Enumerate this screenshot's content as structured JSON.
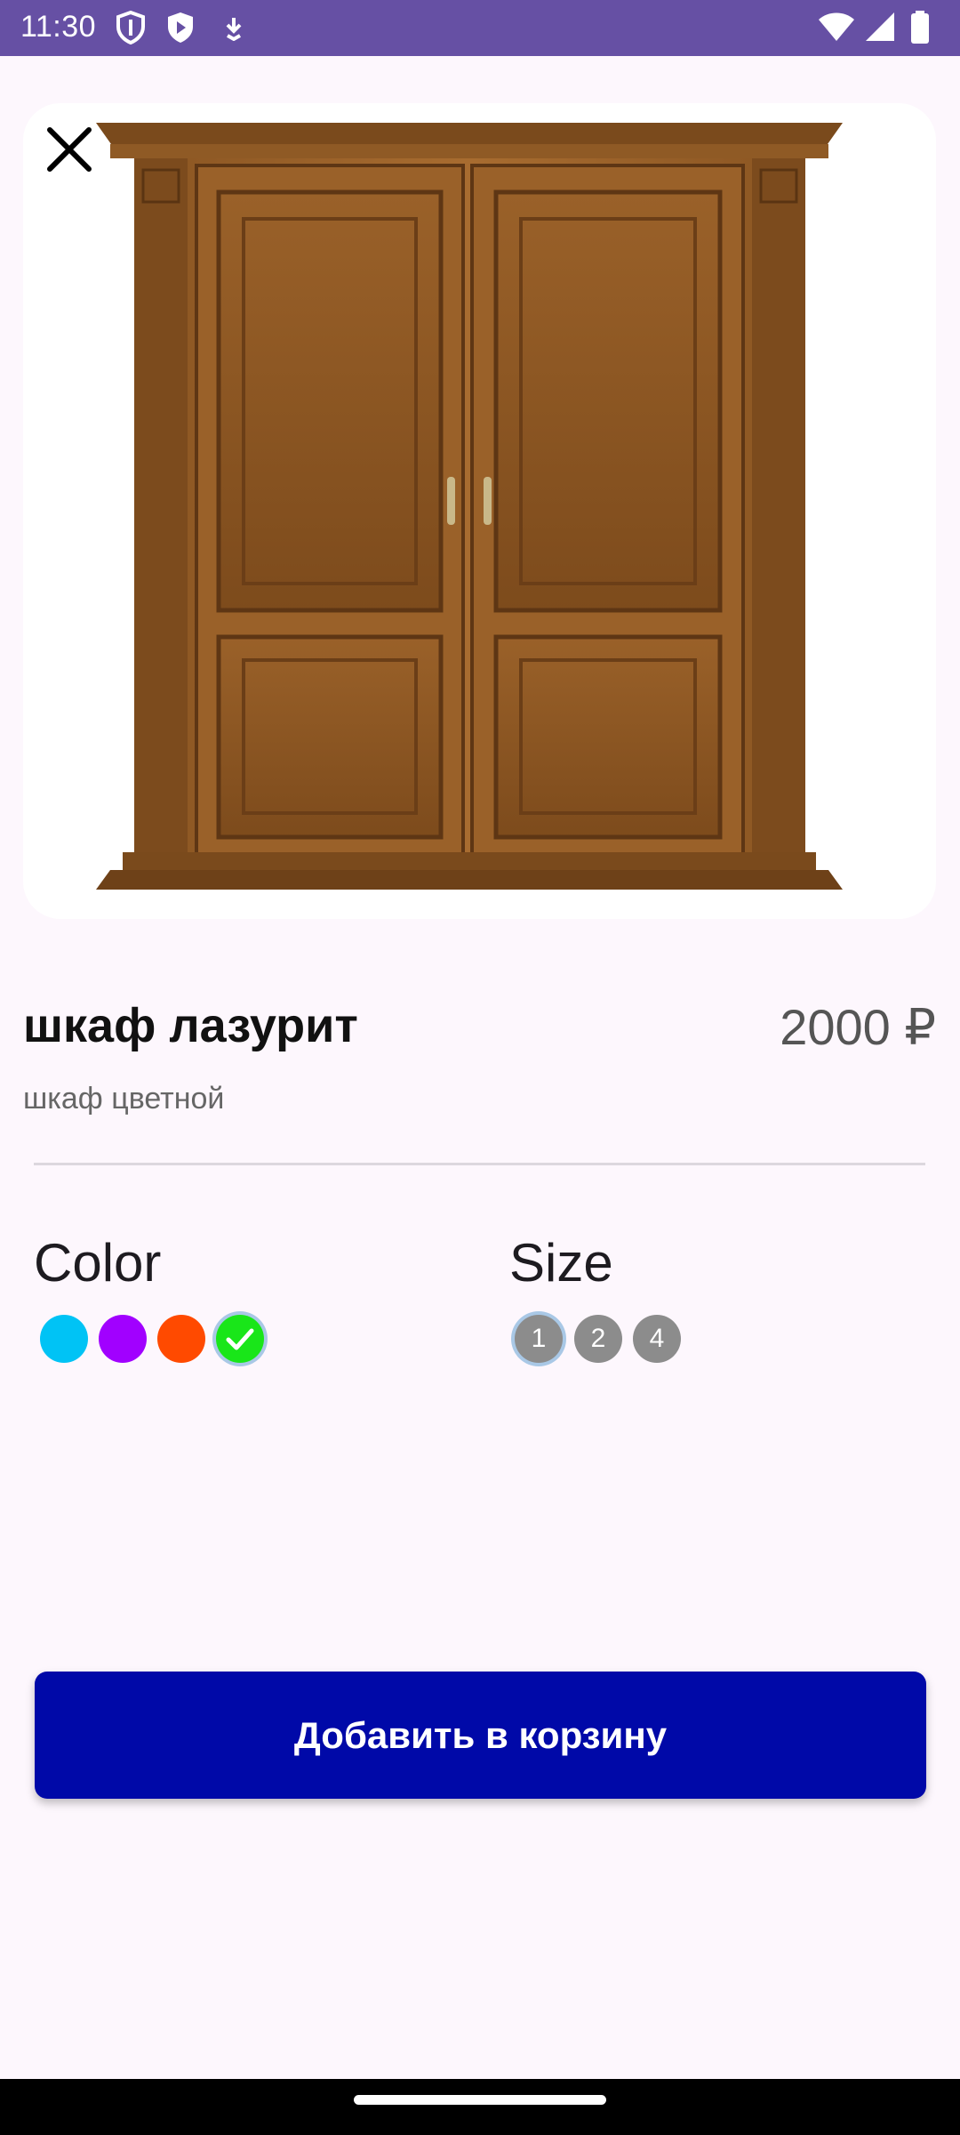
{
  "status_bar": {
    "time": "11:30",
    "left_icons": [
      "shield-icon",
      "play-shield-icon",
      "download-icon"
    ],
    "right_icons": [
      "wifi-icon",
      "signal-icon",
      "battery-icon"
    ],
    "background": "#6650a4"
  },
  "product": {
    "image": "wooden-wardrobe-image",
    "name": "шкаф лазурит",
    "price": "2000 ₽",
    "subtitle": "шкаф цветной"
  },
  "options": {
    "color_label": "Color",
    "colors": [
      {
        "name": "cyan",
        "hex": "#00c3f5",
        "selected": false
      },
      {
        "name": "purple",
        "hex": "#a100ff",
        "selected": false
      },
      {
        "name": "orange-red",
        "hex": "#ff4a00",
        "selected": false
      },
      {
        "name": "green",
        "hex": "#19e619",
        "selected": true
      }
    ],
    "size_label": "Size",
    "sizes": [
      {
        "label": "1",
        "selected": true
      },
      {
        "label": "2",
        "selected": false
      },
      {
        "label": "4",
        "selected": false
      }
    ]
  },
  "actions": {
    "add_to_cart": "Добавить в корзину",
    "close_icon": "close-icon"
  },
  "colors": {
    "primary_button": "#0009a8",
    "background": "#fdf7fd"
  }
}
